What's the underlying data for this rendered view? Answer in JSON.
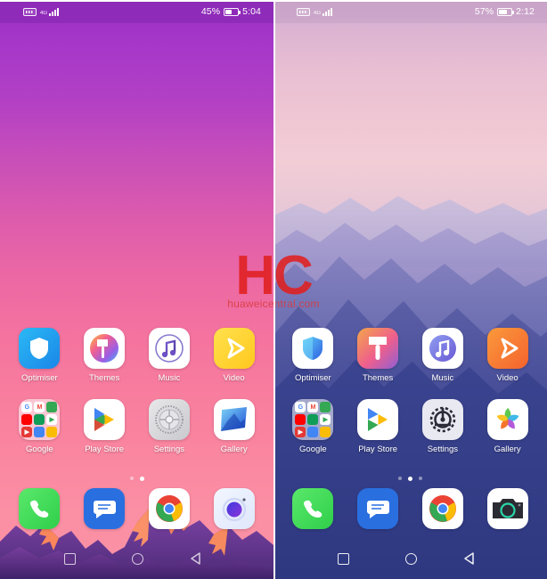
{
  "screens": [
    {
      "id": "left",
      "name": "emui-home-screen-pink",
      "status_bar": {
        "sim_icon": "sim-card-icon",
        "network_label": "4G",
        "signal_icon": "signal-bars-icon",
        "battery_percent": "45%",
        "battery_icon": "battery-icon",
        "clock": "5:04"
      },
      "rows": [
        [
          {
            "label": "Optimiser",
            "icon": "optimiser-icon"
          },
          {
            "label": "Themes",
            "icon": "themes-icon"
          },
          {
            "label": "Music",
            "icon": "music-icon"
          },
          {
            "label": "Video",
            "icon": "video-icon"
          }
        ],
        [
          {
            "label": "Google",
            "icon": "google-folder-icon"
          },
          {
            "label": "Play Store",
            "icon": "play-store-icon"
          },
          {
            "label": "Settings",
            "icon": "settings-icon"
          },
          {
            "label": "Gallery",
            "icon": "gallery-icon"
          }
        ]
      ],
      "dock": [
        {
          "label": "Phone",
          "icon": "phone-icon"
        },
        {
          "label": "Messages",
          "icon": "messages-icon"
        },
        {
          "label": "Chrome",
          "icon": "chrome-icon"
        },
        {
          "label": "Camera",
          "icon": "camera-icon"
        }
      ],
      "page_dots": {
        "count": 2,
        "active_index": 1
      },
      "nav_bar": [
        {
          "icon": "recents-square-icon"
        },
        {
          "icon": "home-circle-icon"
        },
        {
          "icon": "back-triangle-icon"
        }
      ],
      "wallpaper_colors": {
        "top": "#9b30c4",
        "bottom": "#fb92a6",
        "mountain": "#6b3b9c",
        "peak": "#f9865c"
      }
    },
    {
      "id": "right",
      "name": "emui-home-screen-mountains",
      "status_bar": {
        "sim_icon": "sim-card-icon",
        "network_label": "4G",
        "signal_icon": "signal-bars-icon",
        "battery_percent": "57%",
        "battery_icon": "battery-icon",
        "clock": "2:12"
      },
      "rows": [
        [
          {
            "label": "Optimiser",
            "icon": "optimiser-icon"
          },
          {
            "label": "Themes",
            "icon": "themes-icon"
          },
          {
            "label": "Music",
            "icon": "music-icon"
          },
          {
            "label": "Video",
            "icon": "video-icon"
          }
        ],
        [
          {
            "label": "Google",
            "icon": "google-folder-icon"
          },
          {
            "label": "Play Store",
            "icon": "play-store-icon"
          },
          {
            "label": "Settings",
            "icon": "settings-icon"
          },
          {
            "label": "Gallery",
            "icon": "gallery-icon"
          }
        ]
      ],
      "dock": [
        {
          "label": "Phone",
          "icon": "phone-icon"
        },
        {
          "label": "Messages",
          "icon": "messages-icon"
        },
        {
          "label": "Chrome",
          "icon": "chrome-icon"
        },
        {
          "label": "Camera",
          "icon": "camera-icon"
        }
      ],
      "page_dots": {
        "count": 3,
        "active_index": 1
      },
      "nav_bar": [
        {
          "icon": "recents-square-icon"
        },
        {
          "icon": "home-circle-icon"
        },
        {
          "icon": "back-triangle-icon"
        }
      ],
      "wallpaper_colors": {
        "top": "#e8bed3",
        "bottom": "#333e86",
        "mountain": "#6f79b4"
      }
    }
  ],
  "folder_apps": [
    "G",
    "M",
    "Maps",
    "YouTube",
    "Drive",
    "Play",
    "Movies",
    "Duo",
    "Photos"
  ],
  "watermark": {
    "logo": "HC",
    "site": "huaweicentral.com",
    "color": "#e02020"
  }
}
